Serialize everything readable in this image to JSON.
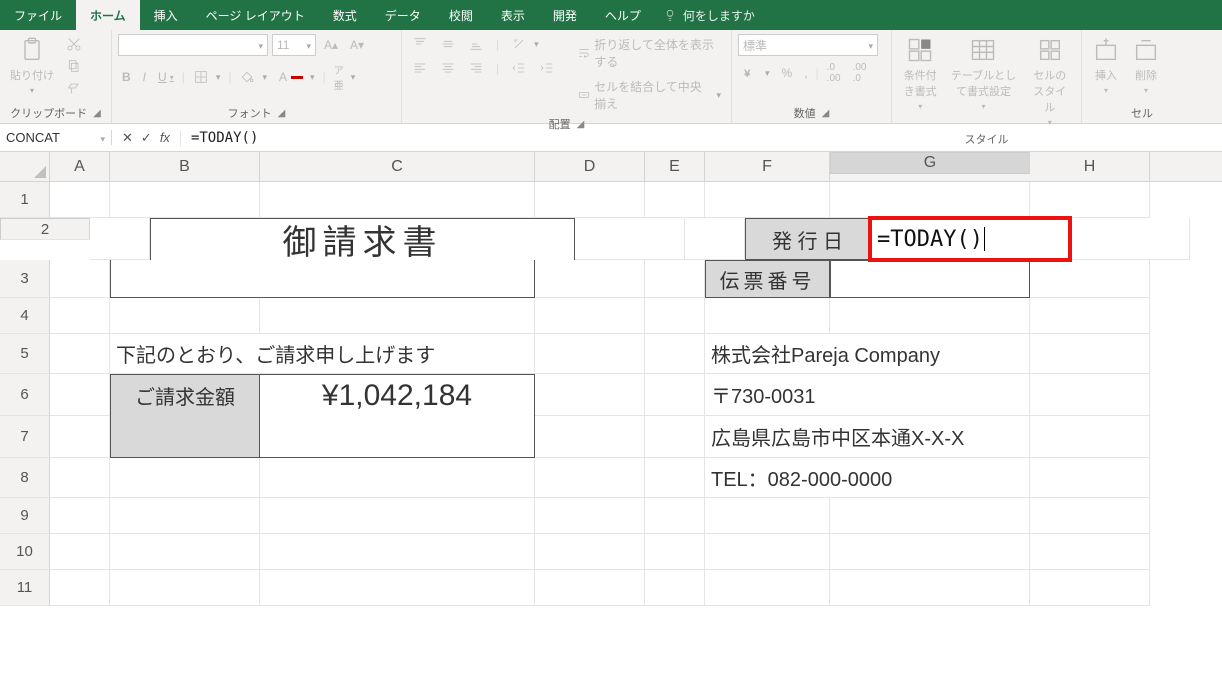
{
  "ribbon": {
    "tabs": [
      "ファイル",
      "ホーム",
      "挿入",
      "ページ レイアウト",
      "数式",
      "データ",
      "校閲",
      "表示",
      "開発",
      "ヘルプ"
    ],
    "active_tab": "ホーム",
    "tellme_placeholder": "何をしますか",
    "groups": {
      "clipboard": {
        "paste": "貼り付け",
        "label": "クリップボード"
      },
      "font": {
        "label": "フォント",
        "font_name": "",
        "font_size": "11",
        "buttons": [
          "B",
          "I",
          "U"
        ]
      },
      "alignment": {
        "label": "配置",
        "wrap": "折り返して全体を表示する",
        "merge": "セルを結合して中央揃え"
      },
      "number": {
        "label": "数値",
        "format": "標準"
      },
      "styles": {
        "label": "スタイル",
        "cond": "条件付き書式",
        "table": "テーブルとして書式設定",
        "cell": "セルのスタイル"
      },
      "cells": {
        "label": "セル",
        "insert": "挿入",
        "delete": "削除"
      }
    }
  },
  "namebox": "CONCAT",
  "formula_bar": "=TODAY()",
  "columns": [
    "A",
    "B",
    "C",
    "D",
    "E",
    "F",
    "G",
    "H"
  ],
  "rows": [
    1,
    2,
    3,
    4,
    5,
    6,
    7,
    8,
    9,
    10,
    11
  ],
  "cells": {
    "title": "御請求書",
    "issue_date_label": "発 行 日",
    "slip_no_label": "伝票番号",
    "editing_value": "=TODAY()",
    "intro": "下記のとおり、ご請求申し上げます",
    "amount_label": "ご請求金額",
    "amount_value": "¥1,042,184",
    "company": "株式会社Pareja Company",
    "postal": "〒730-0031",
    "address": "広島県広島市中区本通X-X-X",
    "tel": "TEL：082-000-0000"
  },
  "active_cell": "G2"
}
